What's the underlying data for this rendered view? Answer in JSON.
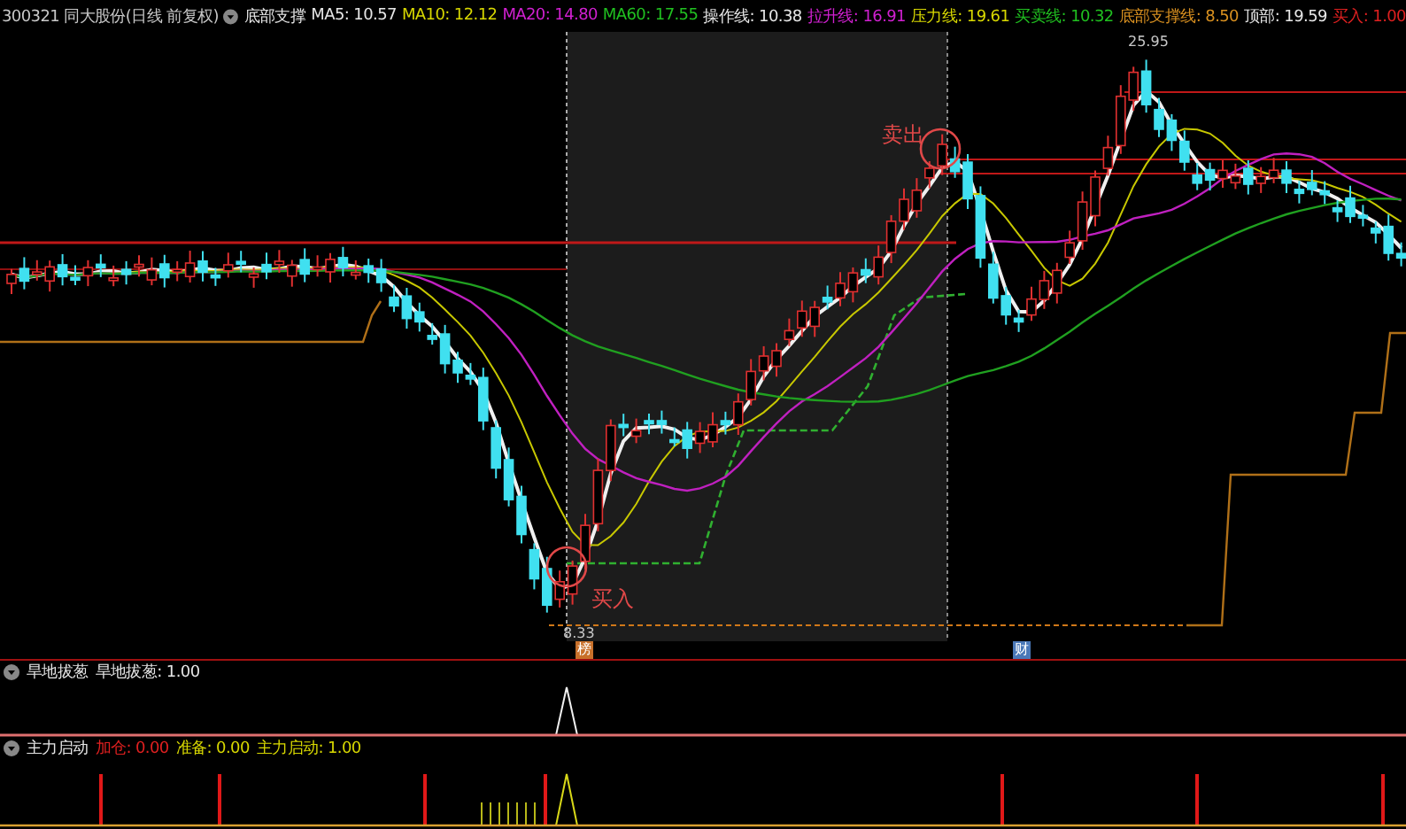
{
  "header": {
    "stock": "300321 同大股份(日线 前复权)",
    "indicator": "底部支撑",
    "items": [
      {
        "text": "MA5: 10.57",
        "color": "#e6e6e6"
      },
      {
        "text": "MA10: 12.12",
        "color": "#d8d800"
      },
      {
        "text": "MA20: 14.80",
        "color": "#d020d0"
      },
      {
        "text": "MA60: 17.55",
        "color": "#20c020"
      },
      {
        "text": "操作线: 10.38",
        "color": "#e6e6e6"
      },
      {
        "text": "拉升线: 16.91",
        "color": "#d020d0"
      },
      {
        "text": "压力线: 19.61",
        "color": "#d8d800"
      },
      {
        "text": "买卖线: 10.32",
        "color": "#20c020"
      },
      {
        "text": "底部支撑线: 8.50",
        "color": "#d89020"
      },
      {
        "text": "顶部: 19.59",
        "color": "#e6e6e6"
      },
      {
        "text": "买入: 1.00",
        "color": "#e02020"
      }
    ]
  },
  "chart": {
    "price_high": "25.95",
    "price_low": "8.33",
    "signals": [
      {
        "kind": "sell",
        "label": "卖出"
      },
      {
        "kind": "buy",
        "label": "买入"
      }
    ],
    "markers": [
      {
        "kind": "rights",
        "label": "榜"
      },
      {
        "kind": "finance",
        "label": "财"
      }
    ]
  },
  "panels": [
    {
      "kind": "spike",
      "name": "旱地拔葱",
      "items": [
        {
          "text": "旱地拔葱: 1.00",
          "color": "#e6e6e6"
        }
      ]
    },
    {
      "kind": "bars",
      "name": "主力启动",
      "items": [
        {
          "text": "加仓: 0.00",
          "color": "#e02020"
        },
        {
          "text": "准备: 0.00",
          "color": "#d8d800"
        },
        {
          "text": "主力启动: 1.00",
          "color": "#d8d800"
        }
      ]
    }
  ]
}
